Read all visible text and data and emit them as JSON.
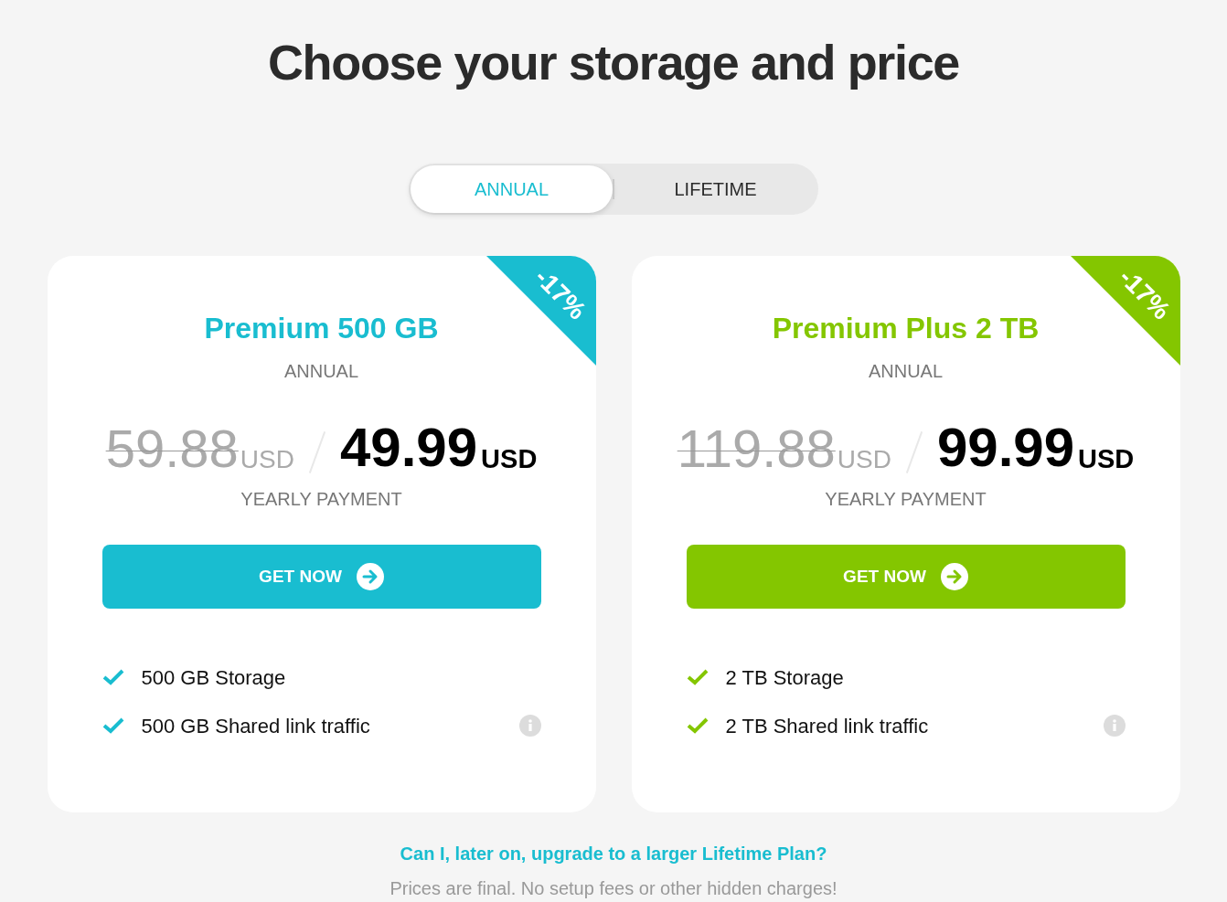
{
  "heading": "Choose your storage and price",
  "billing_tabs": [
    {
      "label": "ANNUAL",
      "selected": true
    },
    {
      "label": "LIFETIME",
      "selected": false
    }
  ],
  "plans": [
    {
      "name": "Premium 500 GB",
      "color": "#19bdd0",
      "discount": "-17%",
      "period": "ANNUAL",
      "old_price": "59.88",
      "old_currency": "USD",
      "price": "49.99",
      "currency": "USD",
      "payment_note": "YEARLY PAYMENT",
      "button": "GET NOW",
      "features": [
        {
          "text": "500 GB Storage",
          "info": false
        },
        {
          "text": "500 GB Shared link traffic",
          "info": true
        }
      ]
    },
    {
      "name": "Premium Plus 2 TB",
      "color": "#84c600",
      "discount": "-17%",
      "period": "ANNUAL",
      "old_price": "119.88",
      "old_currency": "USD",
      "price": "99.99",
      "currency": "USD",
      "payment_note": "YEARLY PAYMENT",
      "button": "GET NOW",
      "features": [
        {
          "text": "2 TB Storage",
          "info": false
        },
        {
          "text": "2 TB Shared link traffic",
          "info": true
        }
      ]
    }
  ],
  "faq_link": "Can I, later on, upgrade to a larger Lifetime Plan?",
  "footnote": "Prices are final. No setup fees or other hidden charges!"
}
